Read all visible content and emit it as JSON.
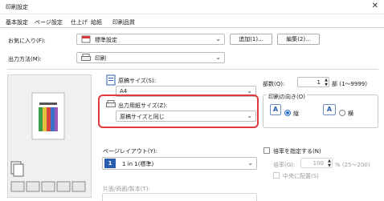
{
  "window": {
    "title": "印刷設定",
    "close_glyph": "✕"
  },
  "tabs": [
    "基本設定",
    "ページ設定",
    "仕上げ",
    "給紙",
    "印刷品質"
  ],
  "favorites": {
    "label": "お気に入り(F):",
    "value": "標準設定",
    "add_button": "追加(1)...",
    "edit_button": "編集(2)..."
  },
  "output_method": {
    "label": "出力方法(M):",
    "value": "印刷"
  },
  "original_size": {
    "label": "原稿サイズ(S):",
    "value": "A4"
  },
  "output_paper_size": {
    "label": "出力用紙サイズ(Z):",
    "value": "原稿サイズと同じ"
  },
  "copies": {
    "label": "部数(Q):",
    "value": "1",
    "range": "部 (1〜9999)"
  },
  "orientation": {
    "label": "印刷の向き(O)",
    "portrait_label": "縦",
    "landscape_label": "横",
    "selected": "縦"
  },
  "page_layout": {
    "label": "ページレイアウト(Y):",
    "number": "1",
    "value": "1 in 1(標準)"
  },
  "zoom": {
    "label": "倍率を指定する(N)",
    "factor_label": "倍率(G):",
    "factor_value": "100",
    "factor_range": "% (25〜200)",
    "center_label": "中央に配置(S)",
    "checked": false
  },
  "duplex": {
    "label": "片面/両面/製本(T):"
  },
  "colors": {
    "accent": "#2a6fd6",
    "highlight": "#e3383c"
  }
}
